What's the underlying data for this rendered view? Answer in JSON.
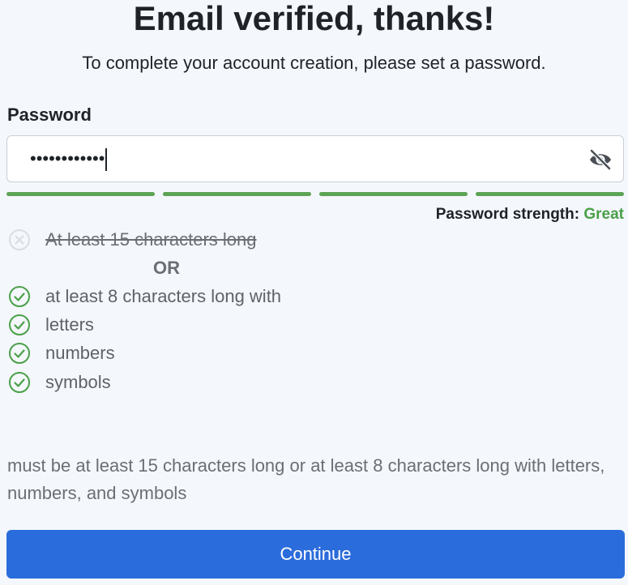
{
  "header": {
    "title": "Email verified, thanks!",
    "subtitle": "To complete your account creation, please set a password."
  },
  "password": {
    "label": "Password",
    "masked_value": "••••••••••••",
    "toggle_icon": "eye-slash-icon",
    "strength_label": "Password strength:",
    "strength_value": "Great",
    "strength_segments_filled": 4,
    "strength_segments_total": 4,
    "bar_color": "#5da356",
    "strength_color": "#4aa048"
  },
  "requirements": {
    "option_a": {
      "text": "At least 15 characters long",
      "met": false,
      "icon": "x-circle-icon"
    },
    "or_label": "OR",
    "option_b": [
      {
        "text": "at least 8 characters long with",
        "met": true,
        "icon": "check-circle-icon"
      },
      {
        "text": "letters",
        "met": true,
        "icon": "check-circle-icon"
      },
      {
        "text": "numbers",
        "met": true,
        "icon": "check-circle-icon"
      },
      {
        "text": "symbols",
        "met": true,
        "icon": "check-circle-icon"
      }
    ]
  },
  "help": {
    "text": "must be at least 15 characters long or at least 8 characters long with letters, numbers, and symbols"
  },
  "actions": {
    "continue_label": "Continue",
    "accent": "#2b6cdc"
  }
}
